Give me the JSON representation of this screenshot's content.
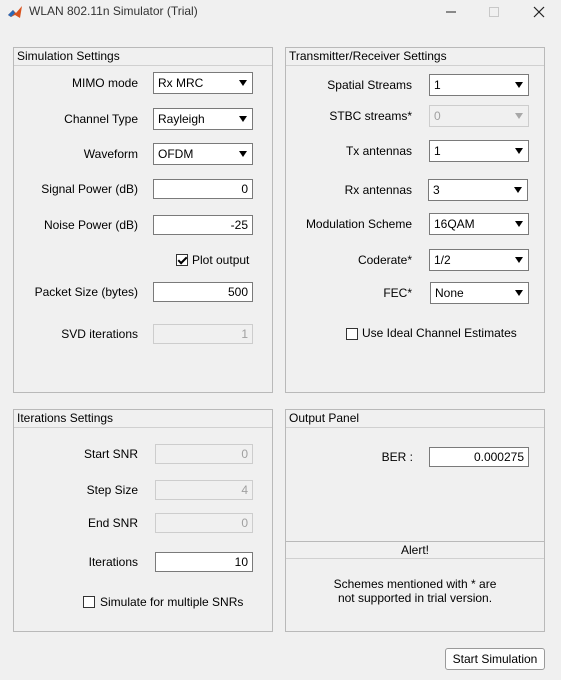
{
  "window": {
    "title": "WLAN 802.11n Simulator (Trial)"
  },
  "simulation": {
    "panel_title": "Simulation Settings",
    "mimo_mode_label": "MIMO mode",
    "mimo_mode_value": "Rx MRC",
    "channel_type_label": "Channel Type",
    "channel_type_value": "Rayleigh",
    "waveform_label": "Waveform",
    "waveform_value": "OFDM",
    "signal_power_label": "Signal Power (dB)",
    "signal_power_value": "0",
    "noise_power_label": "Noise Power (dB)",
    "noise_power_value": "-25",
    "plot_output_label": "Plot output",
    "plot_output_checked": true,
    "packet_size_label": "Packet Size (bytes)",
    "packet_size_value": "500",
    "svd_iterations_label": "SVD iterations",
    "svd_iterations_value": "1"
  },
  "txrx": {
    "panel_title": "Transmitter/Receiver Settings",
    "spatial_streams_label": "Spatial Streams",
    "spatial_streams_value": "1",
    "stbc_streams_label": "STBC streams*",
    "stbc_streams_value": "0",
    "tx_antennas_label": "Tx antennas",
    "tx_antennas_value": "1",
    "rx_antennas_label": "Rx antennas",
    "rx_antennas_value": "3",
    "modulation_label": "Modulation Scheme",
    "modulation_value": "16QAM",
    "coderate_label": "Coderate*",
    "coderate_value": "1/2",
    "fec_label": "FEC*",
    "fec_value": "None",
    "ideal_channel_label": "Use Ideal Channel Estimates",
    "ideal_channel_checked": false
  },
  "iterations": {
    "panel_title": "Iterations Settings",
    "start_snr_label": "Start SNR",
    "start_snr_value": "0",
    "step_size_label": "Step Size",
    "step_size_value": "4",
    "end_snr_label": "End SNR",
    "end_snr_value": "0",
    "iterations_label": "Iterations",
    "iterations_value": "10",
    "multiple_snr_label": "Simulate for multiple SNRs",
    "multiple_snr_checked": false
  },
  "output": {
    "panel_title": "Output Panel",
    "ber_label": "BER :",
    "ber_value": "0.000275",
    "alert_title": "Alert!",
    "alert_line1": "Schemes mentioned with * are",
    "alert_line2": "not supported in trial version."
  },
  "actions": {
    "start_simulation_label": "Start Simulation"
  },
  "colors": {
    "window_bg": "#f0f0f0",
    "panel_border": "#b9b9b9",
    "field_border": "#7a7a7a",
    "disabled_text": "#a0a0a0"
  },
  "icons": {
    "app": "matlab-icon",
    "minimize": "minimize-icon",
    "maximize": "maximize-icon",
    "close": "close-icon"
  }
}
